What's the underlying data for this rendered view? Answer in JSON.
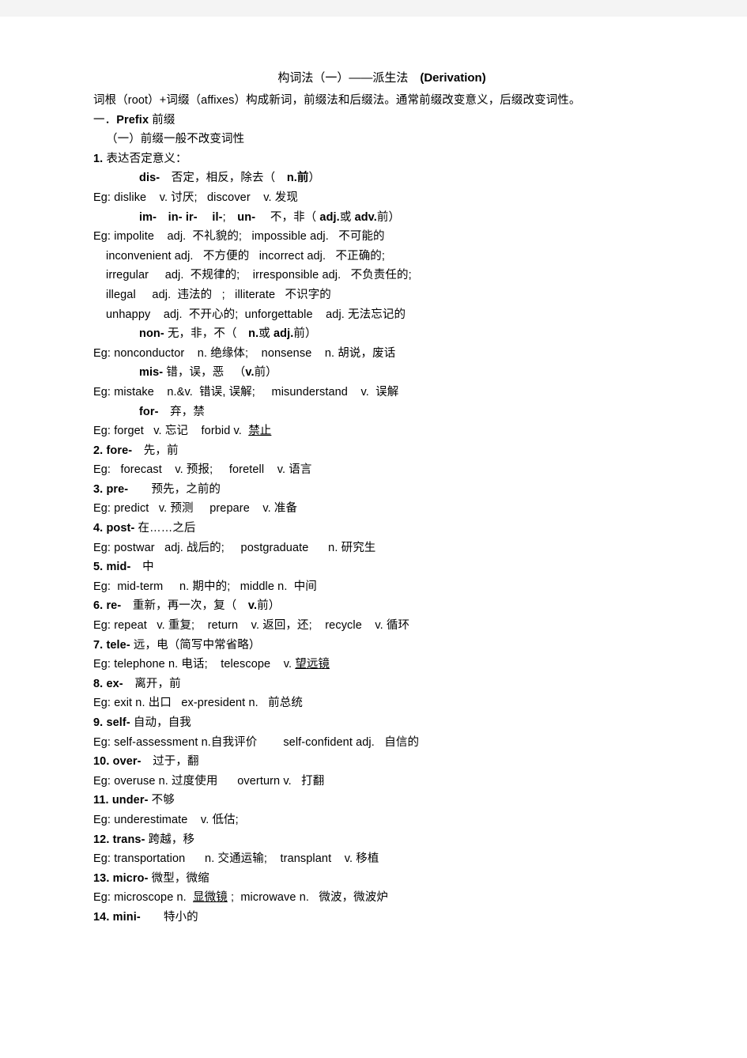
{
  "document": {
    "title_cn": "构词法（一）——派生法",
    "title_en": "(Derivation)",
    "intro": "词根（root）+词缀（affixes）构成新词，前缀法和后缀法。通常前缀改变意义，后缀改变词性。",
    "section_heading_num": "一．",
    "section_heading_en": "Prefix",
    "section_heading_cn": "前缀",
    "subsection": "（一）前缀一般不改变词性",
    "group1_num": "1.",
    "group1_label": "表达否定意义："
  },
  "entries": [
    {
      "id": "dis",
      "prefix": "dis-",
      "gloss": "否定，相反，除去（",
      "pos_note": "n.前",
      "pos_close": "）",
      "example_label": "Eg:",
      "examples": "dislike    v. 讨厌;   discover    v. 发现"
    },
    {
      "id": "im-in-ir-il-un",
      "prefix_parts": [
        "im-",
        "in-",
        "ir-",
        "il-",
        "un-"
      ],
      "gloss": "不，非（",
      "pos_note_a": "adj.",
      "pos_note_mid": "或",
      "pos_note_b": "adv.",
      "pos_note_tail": "前）",
      "example_label": "Eg:",
      "example_lines": [
        "impolite    adj.  不礼貌的;   impossible adj.   不可能的",
        "inconvenient adj.   不方便的   incorrect adj.   不正确的;",
        "irregular     adj.  不规律的;    irresponsible adj.   不负责任的;",
        "illegal     adj.  违法的   ;   illiterate   不识字的",
        "unhappy    adj.  不开心的;  unforgettable    adj. 无法忘记的"
      ]
    },
    {
      "id": "non",
      "prefix": "non-",
      "gloss": "无，非，不（",
      "pos_note_a": "n.",
      "pos_note_mid": "或",
      "pos_note_b": "adj.",
      "pos_note_tail": "前）",
      "example_label": "Eg:",
      "examples": "nonconductor    n. 绝缘体;    nonsense    n. 胡说，废话"
    },
    {
      "id": "mis",
      "prefix": "mis-",
      "gloss": "错，误，恶   （",
      "pos_note": "v.",
      "pos_note_tail": "前）",
      "example_label": "Eg:",
      "examples": "mistake    n.&v.  错误, 误解;     misunderstand    v.  误解"
    },
    {
      "id": "for",
      "prefix": "for-",
      "gloss": "弃，禁",
      "example_label": "Eg:",
      "examples_pre": "forget   v. 忘记    forbid v.  ",
      "examples_underlined": "禁止"
    }
  ],
  "numbered": [
    {
      "num": "2.",
      "prefix": "fore-",
      "gloss": "先，前",
      "example_label": "Eg:",
      "examples": "  forecast    v. 预报;     foretell    v. 语言"
    },
    {
      "num": "3.",
      "prefix": "pre-",
      "gloss": "预先，之前的",
      "example_label": "Eg:",
      "examples": "predict   v. 预测     prepare    v. 准备"
    },
    {
      "num": "4.",
      "prefix": "post-",
      "gloss": "在……之后",
      "example_label": "Eg:",
      "examples": "postwar   adj. 战后的;     postgraduate      n. 研究生"
    },
    {
      "num": "5.",
      "prefix": "mid-",
      "gloss": "中",
      "example_label": "Eg:",
      "examples": " mid-term     n. 期中的;   middle n.  中间"
    },
    {
      "num": "6.",
      "prefix": "re-",
      "gloss": "重新，再一次，复（",
      "pos_note": "v.",
      "pos_note_tail": "前）",
      "example_label": "Eg:",
      "examples": "repeat   v. 重复;    return    v. 返回，还;    recycle    v. 循环"
    },
    {
      "num": "7.",
      "prefix": "tele-",
      "gloss": "远，电（简写中常省略）",
      "example_label": "Eg:",
      "examples_pre": "telephone n. 电话;    telescope    v. ",
      "examples_underlined": "望远镜"
    },
    {
      "num": "8.",
      "prefix": "ex-",
      "gloss": "离开，前",
      "example_label": "Eg:",
      "examples": "exit n. 出口   ex-president n.   前总统"
    },
    {
      "num": "9.",
      "prefix": "self-",
      "gloss": "自动，自我",
      "example_label": "Eg:",
      "examples": "self-assessment n.自我评价        self-confident adj.   自信的"
    },
    {
      "num": "10.",
      "prefix": "over-",
      "gloss": "过于，翻",
      "example_label": "Eg:",
      "examples": "overuse n. 过度使用      overturn v.   打翻"
    },
    {
      "num": "11.",
      "prefix": "under-",
      "gloss": "不够",
      "example_label": "Eg:",
      "examples": "underestimate    v. 低估;"
    },
    {
      "num": "12.",
      "prefix": "trans-",
      "gloss": "跨越，移",
      "example_label": "Eg:",
      "examples": "transportation      n. 交通运输;    transplant    v. 移植"
    },
    {
      "num": "13.",
      "prefix": "micro-",
      "gloss": "微型，微缩",
      "example_label": "Eg:",
      "examples_pre": "microscope n.  ",
      "examples_underlined": "显微镜",
      "examples_post": " ;  microwave n.   微波，微波炉"
    },
    {
      "num": "14.",
      "prefix": "mini-",
      "gloss": "特小的"
    }
  ]
}
